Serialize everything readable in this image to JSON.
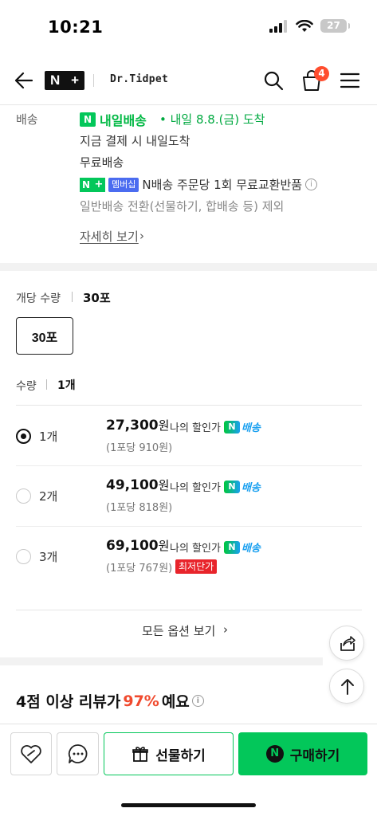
{
  "status_bar": {
    "time": "10:21",
    "battery": "27"
  },
  "header": {
    "brand": "Dr.Tidpet",
    "cart_count": "4"
  },
  "delivery": {
    "label": "배송",
    "badge": "내일배송",
    "date": "• 내일 8.8.(금) 도착",
    "pay_now": "지금 결제 시 내일도착",
    "free": "무료배송",
    "membership_tag": "멤버십",
    "exchange": "N배송 주문당 1회 무료교환반품",
    "exclude": "일반배송 전환(선물하기, 합배송 등) 제외",
    "detail_link": "자세히 보기"
  },
  "options": {
    "unit_label": "개당 수량",
    "unit_value": "30포",
    "unit_button": "30포",
    "qty_label": "수량",
    "qty_value": "1개",
    "rows": [
      {
        "qty": "1개",
        "price": "27,300",
        "won": "원",
        "discount": "나의 할인가",
        "nd": "배송",
        "unit": "(1포당 910원)",
        "badge": ""
      },
      {
        "qty": "2개",
        "price": "49,100",
        "won": "원",
        "discount": "나의 할인가",
        "nd": "배송",
        "unit": "(1포당 818원)",
        "badge": ""
      },
      {
        "qty": "3개",
        "price": "69,100",
        "won": "원",
        "discount": "나의 할인가",
        "nd": "배송",
        "unit": "(1포당 767원)",
        "badge": "최저단가"
      }
    ],
    "all_options": "모든 옵션 보기"
  },
  "review": {
    "prefix": "4점 이상 리뷰가 ",
    "percent": "97%",
    "suffix": "예요"
  },
  "bottom": {
    "gift": "선물하기",
    "buy": "구매하기"
  }
}
